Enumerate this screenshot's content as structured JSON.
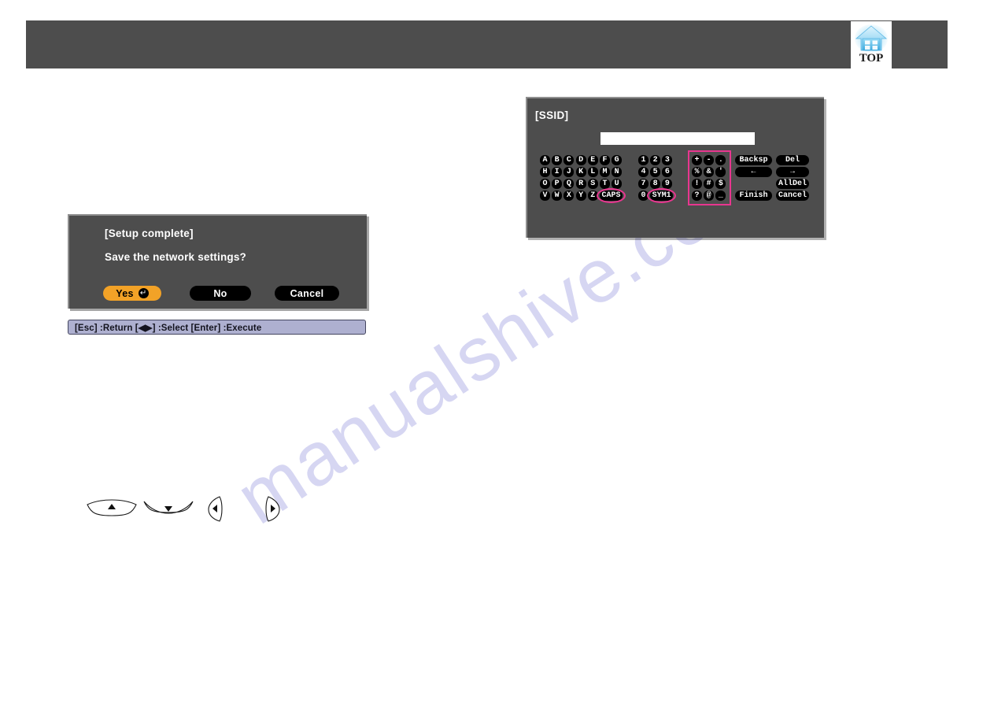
{
  "page": {
    "watermark": "manualshive.com",
    "background_color": "#ffffff",
    "header_color": "#4d4d4d",
    "panel_color": "#4d4d4d",
    "accent_color": "#f2a227",
    "annotation_color": "#e8368f",
    "status_bar_color": "#aeb0d0"
  },
  "header": {
    "top_button_label": "TOP",
    "top_button_icon": "home-house-icon"
  },
  "confirm_dialog": {
    "title": "[Setup complete]",
    "question": "Save the network settings?",
    "buttons": [
      {
        "label": "Yes",
        "selected": true,
        "enter_glyph": "↵"
      },
      {
        "label": "No",
        "selected": false
      },
      {
        "label": "Cancel",
        "selected": false
      }
    ]
  },
  "status_bar": {
    "text": "[Esc] :Return  [◀▶] :Select   [Enter] :Execute"
  },
  "ssid_panel": {
    "title": "[SSID]",
    "input_value": "",
    "input_placeholder": "",
    "letter_rows": [
      [
        "A",
        "B",
        "C",
        "D",
        "E",
        "F",
        "G"
      ],
      [
        "H",
        "I",
        "J",
        "K",
        "L",
        "M",
        "N"
      ],
      [
        "O",
        "P",
        "Q",
        "R",
        "S",
        "T",
        "U"
      ],
      [
        "V",
        "W",
        "X",
        "Y",
        "Z"
      ]
    ],
    "caps_key": "CAPS",
    "number_rows": [
      [
        "1",
        "2",
        "3"
      ],
      [
        "4",
        "5",
        "6"
      ],
      [
        "7",
        "8",
        "9"
      ],
      [
        "0"
      ]
    ],
    "sym_key": "SYM1",
    "symbol_rows": [
      [
        "+",
        "-",
        "."
      ],
      [
        "%",
        "&",
        "'"
      ],
      [
        "!",
        "#",
        "$"
      ],
      [
        "?",
        "@",
        "_"
      ]
    ],
    "function_keys": {
      "backspace": "Backsp",
      "delete": "Del",
      "arrow_left": "←",
      "arrow_right": "→",
      "all_delete": "AllDel",
      "finish": "Finish",
      "cancel": "Cancel"
    },
    "annotations": [
      {
        "name": "symbol-grid-highlight",
        "shape": "rectangle"
      },
      {
        "name": "caps-key-highlight",
        "shape": "ellipse"
      },
      {
        "name": "sym1-key-highlight",
        "shape": "ellipse"
      }
    ]
  },
  "direction_buttons": [
    {
      "name": "up-arrow-button",
      "glyph": "▲"
    },
    {
      "name": "down-arrow-button",
      "glyph": "▼"
    },
    {
      "name": "left-arrow-button",
      "glyph": "◀"
    },
    {
      "name": "right-arrow-button",
      "glyph": "▶"
    }
  ]
}
